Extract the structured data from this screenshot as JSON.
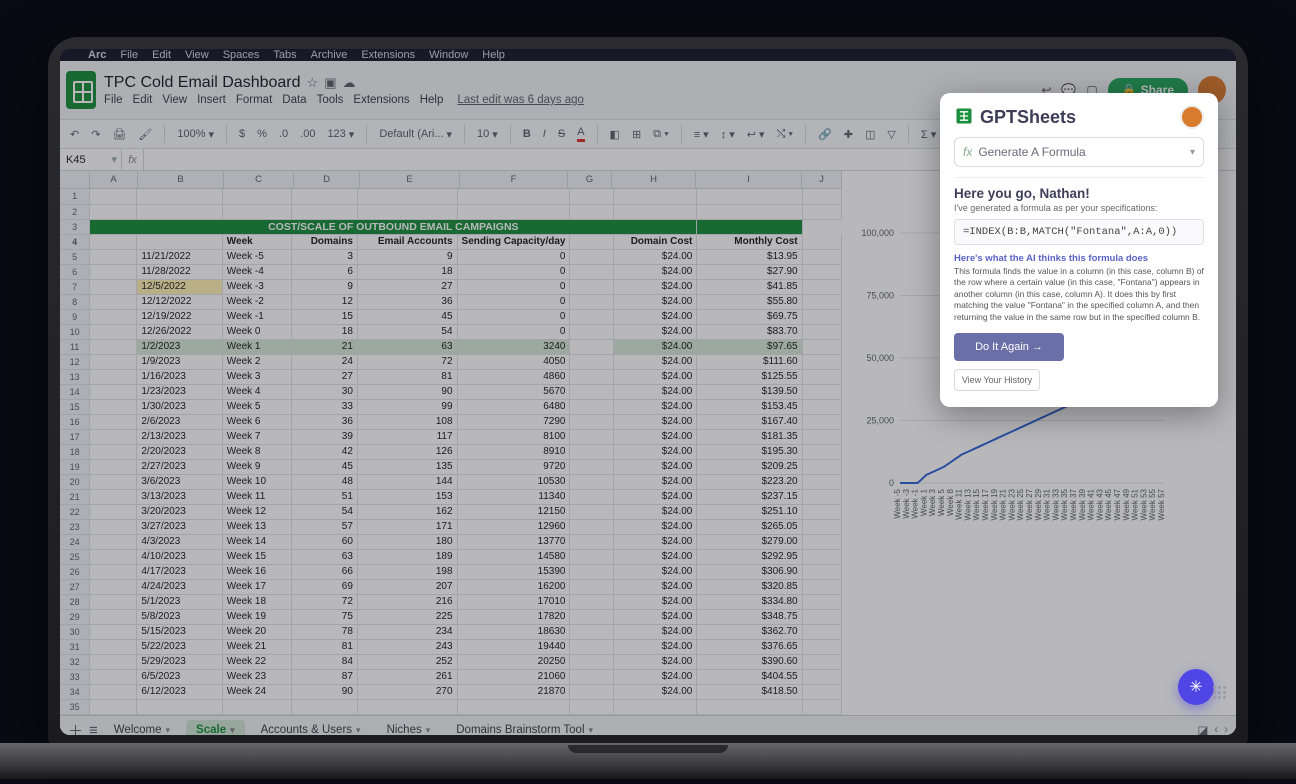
{
  "menubar": {
    "apple": "",
    "items": [
      "Arc",
      "File",
      "Edit",
      "View",
      "Spaces",
      "Tabs",
      "Archive",
      "Extensions",
      "Window",
      "Help"
    ]
  },
  "doc": {
    "title": "TPC Cold Email Dashboard",
    "menus": [
      "File",
      "Edit",
      "View",
      "Insert",
      "Format",
      "Data",
      "Tools",
      "Extensions",
      "Help"
    ],
    "last_edit": "Last edit was 6 days ago",
    "share": "Share",
    "name_box": "K45"
  },
  "toolbar": {
    "zoom": "100%",
    "font": "Default (Ari...",
    "size": "10",
    "fmt": "123"
  },
  "columns": [
    "A",
    "B",
    "C",
    "D",
    "E",
    "F",
    "G",
    "H",
    "I",
    "J"
  ],
  "banner": "COST/SCALE OF OUTBOUND EMAIL CAMPAIGNS",
  "headers": {
    "B": "",
    "C": "Week",
    "D": "Domains",
    "E": "Email Accounts",
    "F": "Sending Capacity/day",
    "H": "Domain Cost",
    "I": "Monthly Cost"
  },
  "rows": [
    {
      "r": 5,
      "B": "11/21/2022",
      "C": "Week -5",
      "D": 3,
      "E": 9,
      "F": 0,
      "H": "$24.00",
      "I": "$13.95"
    },
    {
      "r": 6,
      "B": "11/28/2022",
      "C": "Week -4",
      "D": 6,
      "E": 18,
      "F": 0,
      "H": "$24.00",
      "I": "$27.90"
    },
    {
      "r": 7,
      "B": "12/5/2022",
      "C": "Week -3",
      "D": 9,
      "E": 27,
      "F": 0,
      "H": "$24.00",
      "I": "$41.85",
      "hl": "date"
    },
    {
      "r": 8,
      "B": "12/12/2022",
      "C": "Week -2",
      "D": 12,
      "E": 36,
      "F": 0,
      "H": "$24.00",
      "I": "$55.80"
    },
    {
      "r": 9,
      "B": "12/19/2022",
      "C": "Week -1",
      "D": 15,
      "E": 45,
      "F": 0,
      "H": "$24.00",
      "I": "$69.75"
    },
    {
      "r": 10,
      "B": "12/26/2022",
      "C": "Week 0",
      "D": 18,
      "E": 54,
      "F": 0,
      "H": "$24.00",
      "I": "$83.70"
    },
    {
      "r": 11,
      "B": "1/2/2023",
      "C": "Week 1",
      "D": 21,
      "E": 63,
      "F": 3240,
      "H": "$24.00",
      "I": "$97.65",
      "hl": "row"
    },
    {
      "r": 12,
      "B": "1/9/2023",
      "C": "Week 2",
      "D": 24,
      "E": 72,
      "F": 4050,
      "H": "$24.00",
      "I": "$111.60"
    },
    {
      "r": 13,
      "B": "1/16/2023",
      "C": "Week 3",
      "D": 27,
      "E": 81,
      "F": 4860,
      "H": "$24.00",
      "I": "$125.55"
    },
    {
      "r": 14,
      "B": "1/23/2023",
      "C": "Week 4",
      "D": 30,
      "E": 90,
      "F": 5670,
      "H": "$24.00",
      "I": "$139.50"
    },
    {
      "r": 15,
      "B": "1/30/2023",
      "C": "Week 5",
      "D": 33,
      "E": 99,
      "F": 6480,
      "H": "$24.00",
      "I": "$153.45"
    },
    {
      "r": 16,
      "B": "2/6/2023",
      "C": "Week 6",
      "D": 36,
      "E": 108,
      "F": 7290,
      "H": "$24.00",
      "I": "$167.40"
    },
    {
      "r": 17,
      "B": "2/13/2023",
      "C": "Week 7",
      "D": 39,
      "E": 117,
      "F": 8100,
      "H": "$24.00",
      "I": "$181.35"
    },
    {
      "r": 18,
      "B": "2/20/2023",
      "C": "Week 8",
      "D": 42,
      "E": 126,
      "F": 8910,
      "H": "$24.00",
      "I": "$195.30"
    },
    {
      "r": 19,
      "B": "2/27/2023",
      "C": "Week 9",
      "D": 45,
      "E": 135,
      "F": 9720,
      "H": "$24.00",
      "I": "$209.25"
    },
    {
      "r": 20,
      "B": "3/6/2023",
      "C": "Week 10",
      "D": 48,
      "E": 144,
      "F": 10530,
      "H": "$24.00",
      "I": "$223.20"
    },
    {
      "r": 21,
      "B": "3/13/2023",
      "C": "Week 11",
      "D": 51,
      "E": 153,
      "F": 11340,
      "H": "$24.00",
      "I": "$237.15"
    },
    {
      "r": 22,
      "B": "3/20/2023",
      "C": "Week 12",
      "D": 54,
      "E": 162,
      "F": 12150,
      "H": "$24.00",
      "I": "$251.10"
    },
    {
      "r": 23,
      "B": "3/27/2023",
      "C": "Week 13",
      "D": 57,
      "E": 171,
      "F": 12960,
      "H": "$24.00",
      "I": "$265.05"
    },
    {
      "r": 24,
      "B": "4/3/2023",
      "C": "Week 14",
      "D": 60,
      "E": 180,
      "F": 13770,
      "H": "$24.00",
      "I": "$279.00"
    },
    {
      "r": 25,
      "B": "4/10/2023",
      "C": "Week 15",
      "D": 63,
      "E": 189,
      "F": 14580,
      "H": "$24.00",
      "I": "$292.95"
    },
    {
      "r": 26,
      "B": "4/17/2023",
      "C": "Week 16",
      "D": 66,
      "E": 198,
      "F": 15390,
      "H": "$24.00",
      "I": "$306.90"
    },
    {
      "r": 27,
      "B": "4/24/2023",
      "C": "Week 17",
      "D": 69,
      "E": 207,
      "F": 16200,
      "H": "$24.00",
      "I": "$320.85"
    },
    {
      "r": 28,
      "B": "5/1/2023",
      "C": "Week 18",
      "D": 72,
      "E": 216,
      "F": 17010,
      "H": "$24.00",
      "I": "$334.80"
    },
    {
      "r": 29,
      "B": "5/8/2023",
      "C": "Week 19",
      "D": 75,
      "E": 225,
      "F": 17820,
      "H": "$24.00",
      "I": "$348.75"
    },
    {
      "r": 30,
      "B": "5/15/2023",
      "C": "Week 20",
      "D": 78,
      "E": 234,
      "F": 18630,
      "H": "$24.00",
      "I": "$362.70"
    },
    {
      "r": 31,
      "B": "5/22/2023",
      "C": "Week 21",
      "D": 81,
      "E": 243,
      "F": 19440,
      "H": "$24.00",
      "I": "$376.65"
    },
    {
      "r": 32,
      "B": "5/29/2023",
      "C": "Week 22",
      "D": 84,
      "E": 252,
      "F": 20250,
      "H": "$24.00",
      "I": "$390.60"
    },
    {
      "r": 33,
      "B": "6/5/2023",
      "C": "Week 23",
      "D": 87,
      "E": 261,
      "F": 21060,
      "H": "$24.00",
      "I": "$404.55"
    },
    {
      "r": 34,
      "B": "6/12/2023",
      "C": "Week 24",
      "D": 90,
      "E": 270,
      "F": 21870,
      "H": "$24.00",
      "I": "$418.50"
    }
  ],
  "sheet_tabs": [
    {
      "label": "Welcome"
    },
    {
      "label": "Scale",
      "active": true
    },
    {
      "label": "Accounts & Users"
    },
    {
      "label": "Niches"
    },
    {
      "label": "Domains Brainstorm Tool"
    }
  ],
  "chart_data": {
    "type": "line",
    "title": "",
    "xlabel": "",
    "ylabel": "",
    "ylim": [
      0,
      100000
    ],
    "y_ticks": [
      0,
      25000,
      50000,
      75000,
      100000
    ],
    "categories": [
      "Week -5",
      "Week -3",
      "Week -1",
      "Week 1",
      "Week 3",
      "Week 5",
      "Week 8",
      "Week 11",
      "Week 13",
      "Week 15",
      "Week 17",
      "Week 19",
      "Week 21",
      "Week 23",
      "Week 25",
      "Week 27",
      "Week 29",
      "Week 31",
      "Week 33",
      "Week 35",
      "Week 37",
      "Week 39",
      "Week 41",
      "Week 43",
      "Week 45",
      "Week 47",
      "Week 49",
      "Week 51",
      "Week 53",
      "Week 55",
      "Week 57"
    ],
    "values": [
      0,
      0,
      0,
      3240,
      4860,
      6480,
      8910,
      11340,
      12960,
      14580,
      16200,
      17820,
      19440,
      21060,
      22680,
      24300,
      25920,
      27540,
      29160,
      30780,
      32400,
      34020,
      35640,
      37260,
      38880,
      40500,
      42120,
      43740,
      45360,
      46980,
      48600
    ]
  },
  "panel": {
    "brand": "GPTSheets",
    "prompt": "Generate A Formula",
    "heading": "Here you go, Nathan!",
    "sub": "I've generated a formula as per your specifications:",
    "formula": "=INDEX(B:B,MATCH(\"Fontana\",A:A,0))",
    "explain_title": "Here's what the AI thinks this formula does",
    "explain": "This formula finds the value in a column (in this case, column B) of the row where a certain value (in this case, \"Fontana\") appears in another column (in this case, column A). It does this by first matching the value \"Fontana\" in the specified column A, and then returning the value in the same row but in the specified column B.",
    "again": "Do It Again →",
    "history": "View Your History"
  }
}
